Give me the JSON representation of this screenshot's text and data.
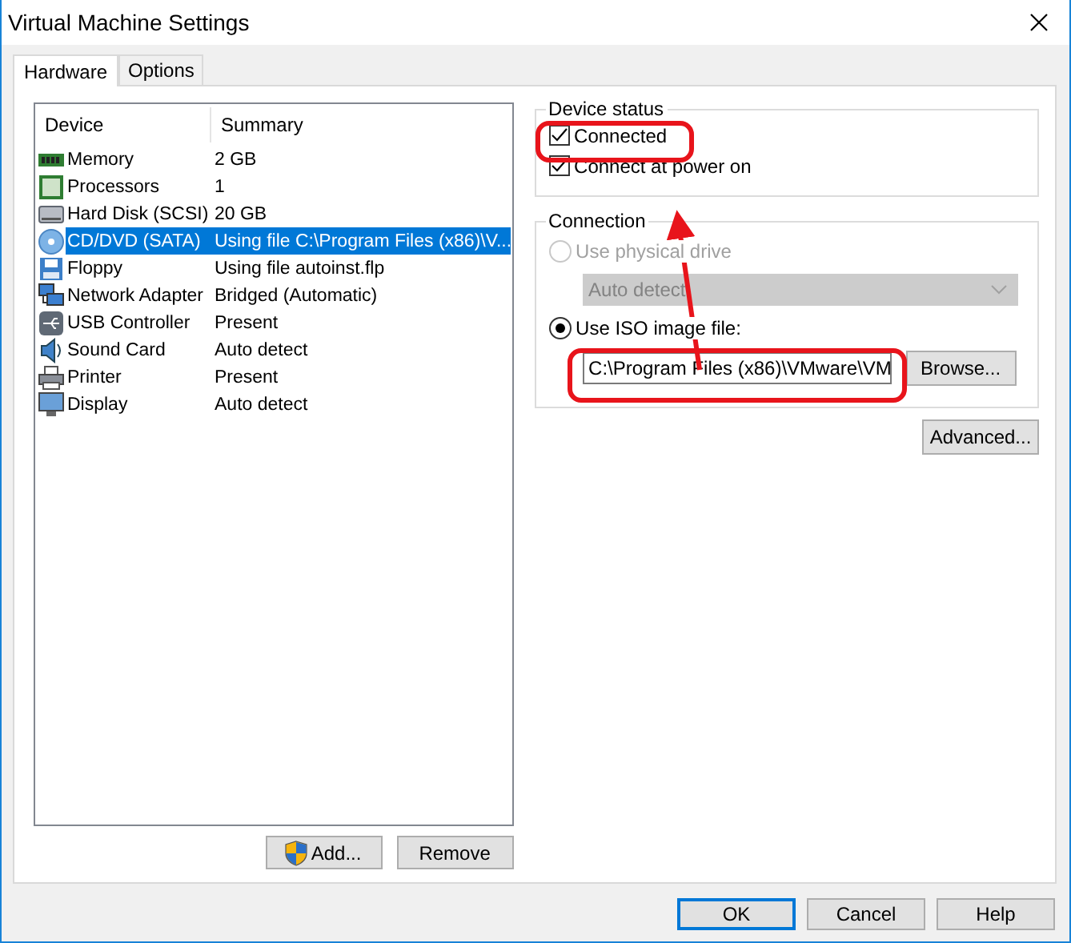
{
  "window": {
    "title": "Virtual Machine Settings"
  },
  "tabs": [
    {
      "label": "Hardware",
      "selected": true
    },
    {
      "label": "Options",
      "selected": false
    }
  ],
  "devices": {
    "columns": [
      "Device",
      "Summary"
    ],
    "rows": [
      {
        "kind": "memory",
        "name": "Memory",
        "summary": "2 GB",
        "selected": false
      },
      {
        "kind": "processor",
        "name": "Processors",
        "summary": "1",
        "selected": false
      },
      {
        "kind": "disk",
        "name": "Hard Disk (SCSI)",
        "summary": "20 GB",
        "selected": false
      },
      {
        "kind": "cd",
        "name": "CD/DVD (SATA)",
        "summary": "Using file C:\\Program Files (x86)\\V...",
        "selected": true
      },
      {
        "kind": "floppy",
        "name": "Floppy",
        "summary": "Using file autoinst.flp",
        "selected": false
      },
      {
        "kind": "network",
        "name": "Network Adapter",
        "summary": "Bridged (Automatic)",
        "selected": false
      },
      {
        "kind": "usb",
        "name": "USB Controller",
        "summary": "Present",
        "selected": false
      },
      {
        "kind": "sound",
        "name": "Sound Card",
        "summary": "Auto detect",
        "selected": false
      },
      {
        "kind": "printer",
        "name": "Printer",
        "summary": "Present",
        "selected": false
      },
      {
        "kind": "display",
        "name": "Display",
        "summary": "Auto detect",
        "selected": false
      }
    ]
  },
  "device_buttons": [
    {
      "label": "Add...",
      "kind": "elevated"
    },
    {
      "label": "Remove",
      "kind": "plain"
    }
  ],
  "device_status": {
    "title": "Device status",
    "options": [
      {
        "label": "Connected",
        "checked": true
      },
      {
        "label": "Connect at power on",
        "checked": true
      }
    ]
  },
  "connection": {
    "title": "Connection",
    "physical": {
      "label": "Use physical drive",
      "selected": false,
      "disabled": true,
      "select": "Auto detect"
    },
    "iso": {
      "label": "Use ISO image file:",
      "selected": true,
      "disabled": false,
      "select": "C:\\Program Files (x86)\\VMware\\VM",
      "browse": "Browse..."
    }
  },
  "advanced": "Advanced...",
  "footer_buttons": [
    {
      "label": "OK",
      "default": true
    },
    {
      "label": "Cancel",
      "default": false
    },
    {
      "label": "Help",
      "default": false
    }
  ]
}
